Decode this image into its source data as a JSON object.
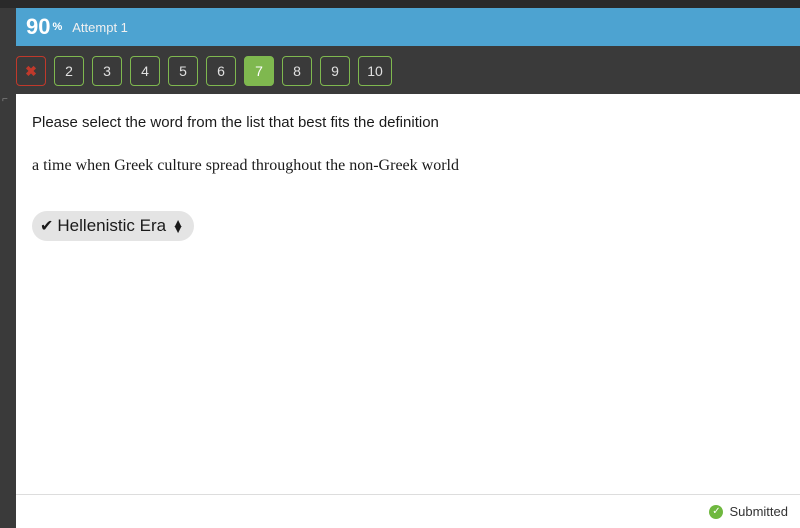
{
  "score": {
    "value": "90",
    "pct": "%",
    "attempt": "Attempt 1"
  },
  "nav": {
    "close": "✖",
    "items": [
      "2",
      "3",
      "4",
      "5",
      "6",
      "7",
      "8",
      "9",
      "10"
    ],
    "active": "7"
  },
  "question": {
    "instruction": "Please select the word from the list that best fits the definition",
    "definition": "a time when Greek culture spread throughout the non-Greek world",
    "selected": "Hellenistic Era",
    "check": "✔"
  },
  "footer": {
    "status": "Submitted",
    "tick": "✓"
  }
}
